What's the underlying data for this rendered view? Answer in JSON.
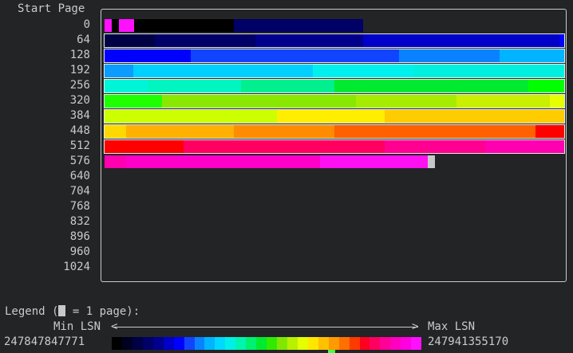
{
  "heatmap": {
    "title": "Start Page",
    "row_labels": [
      "0",
      "64",
      "128",
      "192",
      "256",
      "320",
      "384",
      "448",
      "512",
      "576",
      "640",
      "704",
      "768",
      "832",
      "896",
      "960",
      "1024"
    ]
  },
  "legend": {
    "title_prefix": "Legend (",
    "title_suffix": " = 1 page):",
    "min_label": "Min LSN",
    "max_label": "Max LSN",
    "arrow_left": "<",
    "arrow_right": ">",
    "min_value": "247847847771",
    "max_value": "247941355170",
    "gradient_colors": [
      "#000000",
      "#000022",
      "#000044",
      "#000066",
      "#00008c",
      "#0000c8",
      "#0000ff",
      "#1144ff",
      "#0a82ff",
      "#00b4ff",
      "#00d8ff",
      "#00f0e8",
      "#00f5b0",
      "#00f070",
      "#00ea30",
      "#30ea00",
      "#80e800",
      "#b8f000",
      "#e6ff00",
      "#ffe600",
      "#ffc000",
      "#ff9a00",
      "#ff7000",
      "#ff3a00",
      "#ff0020",
      "#ff0060",
      "#ff0098",
      "#ff00c0",
      "#ff00e0",
      "#ff10ff"
    ],
    "marker_color": "#44ff44"
  },
  "chart_data": {
    "type": "heatmap",
    "title": "Start Page",
    "rows": [
      {
        "start": "0",
        "segments": [
          [
            0.0,
            0.016,
            "#ff10ff"
          ],
          [
            0.016,
            0.031,
            "#000000"
          ],
          [
            0.031,
            0.064,
            "#ff10ff"
          ],
          [
            0.064,
            0.281,
            "#000000"
          ],
          [
            0.281,
            0.563,
            "#000066"
          ]
        ]
      },
      {
        "start": "64",
        "segments": [
          [
            0.0,
            0.109,
            "#000044"
          ],
          [
            0.109,
            0.328,
            "#000066"
          ],
          [
            0.328,
            0.563,
            "#00008c"
          ],
          [
            0.563,
            0.99,
            "#0000c8"
          ],
          [
            0.99,
            1.0,
            "#0000ff"
          ]
        ],
        "bordered": true
      },
      {
        "start": "128",
        "segments": [
          [
            0.0,
            0.188,
            "#0000ff"
          ],
          [
            0.188,
            0.641,
            "#1144ff"
          ],
          [
            0.641,
            0.859,
            "#0a82ff"
          ],
          [
            0.859,
            1.0,
            "#00b4ff"
          ]
        ],
        "bordered": true
      },
      {
        "start": "192",
        "segments": [
          [
            0.0,
            0.063,
            "#0a9cff"
          ],
          [
            0.063,
            0.453,
            "#00d0ff"
          ],
          [
            0.453,
            0.672,
            "#00f0f0"
          ],
          [
            0.672,
            1.0,
            "#00f0e0"
          ]
        ],
        "bordered": true
      },
      {
        "start": "256",
        "segments": [
          [
            0.0,
            0.094,
            "#00f5d8"
          ],
          [
            0.094,
            0.297,
            "#00f5c0"
          ],
          [
            0.297,
            0.5,
            "#00f090"
          ],
          [
            0.5,
            0.922,
            "#00ea30"
          ],
          [
            0.922,
            1.0,
            "#00ff00"
          ]
        ],
        "bordered": true
      },
      {
        "start": "320",
        "segments": [
          [
            0.0,
            0.125,
            "#20ff00"
          ],
          [
            0.125,
            0.547,
            "#8ae800"
          ],
          [
            0.547,
            0.766,
            "#a6ec00"
          ],
          [
            0.766,
            0.969,
            "#c8f000"
          ],
          [
            0.969,
            1.0,
            "#e6ff00"
          ]
        ],
        "bordered": true
      },
      {
        "start": "384",
        "segments": [
          [
            0.0,
            0.375,
            "#ccff00"
          ],
          [
            0.375,
            0.609,
            "#ffee00"
          ],
          [
            0.609,
            1.0,
            "#ffcc00"
          ]
        ],
        "bordered": true
      },
      {
        "start": "448",
        "segments": [
          [
            0.0,
            0.047,
            "#ffd800"
          ],
          [
            0.047,
            0.281,
            "#ffb000"
          ],
          [
            0.281,
            0.5,
            "#ff8c00"
          ],
          [
            0.5,
            0.938,
            "#ff6000"
          ],
          [
            0.938,
            1.0,
            "#ff0000"
          ]
        ],
        "bordered": true
      },
      {
        "start": "512",
        "segments": [
          [
            0.0,
            0.172,
            "#ff0000"
          ],
          [
            0.172,
            0.609,
            "#ff0060"
          ],
          [
            0.609,
            0.828,
            "#ff0090"
          ],
          [
            0.828,
            1.0,
            "#ff00b0"
          ]
        ],
        "bordered": true
      },
      {
        "start": "576",
        "segments": [
          [
            0.0,
            0.047,
            "#ff00b0"
          ],
          [
            0.047,
            0.469,
            "#ff00c8"
          ],
          [
            0.469,
            0.703,
            "#ff10f0"
          ],
          [
            0.703,
            0.719,
            "#c8c8c8"
          ]
        ]
      }
    ]
  }
}
